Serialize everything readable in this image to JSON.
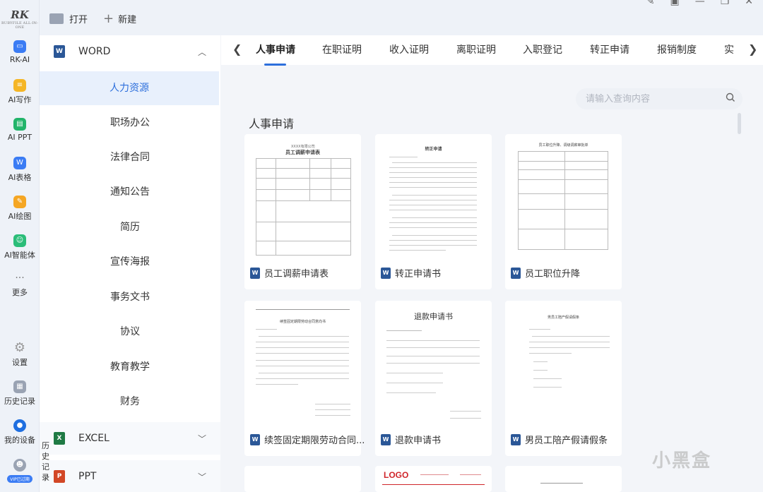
{
  "app": {
    "logo_text": "RK",
    "logo_subtext": "RUBYFILE ALL-IN-ONE"
  },
  "rail": [
    {
      "label": "RK-AI",
      "icon": "rk-ai-icon",
      "color": "#3b7cf4"
    },
    {
      "label": "AI写作",
      "icon": "ai-write-icon",
      "color": "#f5b626"
    },
    {
      "label": "AI PPT",
      "icon": "ai-ppt-icon",
      "color": "#22b46a"
    },
    {
      "label": "AI表格",
      "icon": "ai-table-icon",
      "color": "#3b7cf4"
    },
    {
      "label": "AI绘图",
      "icon": "ai-draw-icon",
      "color": "#f5a623"
    },
    {
      "label": "AI智能体",
      "icon": "ai-agent-icon",
      "color": "#2bbd79"
    },
    {
      "label": "更多",
      "icon": "more-icon",
      "color": "#777777"
    },
    {
      "label": "设置",
      "icon": "gear-icon",
      "color": "#9aa3b3"
    },
    {
      "label": "历史记录",
      "icon": "history-icon",
      "color": "#9aa3b3"
    },
    {
      "label": "我的设备",
      "icon": "device-icon",
      "color": "#1f6fe0"
    },
    {
      "label": "VIP已过期",
      "icon": "avatar-icon",
      "color": "#9aa3b3"
    }
  ],
  "topbar": {
    "open_label": "打开",
    "new_label": "新建"
  },
  "categories": {
    "word": {
      "label": "WORD",
      "badge": "W",
      "color": "#2b5797"
    },
    "word_items": [
      "人力资源",
      "职场办公",
      "法律合同",
      "通知公告",
      "简历",
      "宣传海报",
      "事务文书",
      "协议",
      "教育教学",
      "财务"
    ],
    "excel": {
      "label": "EXCEL",
      "badge": "X",
      "color": "#1f7a44"
    },
    "ppt": {
      "label": "PPT",
      "badge": "P",
      "color": "#d24726"
    },
    "vertical_text": "历史记录"
  },
  "tabs": [
    "人事申请",
    "在职证明",
    "收入证明",
    "离职证明",
    "入职登记",
    "转正申请",
    "报销制度",
    "实"
  ],
  "search": {
    "placeholder": "请输入查询内容"
  },
  "section_title": "人事申请",
  "cards": [
    {
      "title": "员工调薪申请表",
      "doc_heading": "员工调薪申请表",
      "doc_company": "XXXX有限公司"
    },
    {
      "title": "转正申请书",
      "doc_heading": "转正申请"
    },
    {
      "title": "员工职位升降",
      "doc_heading": "员工职位升降、调级调薪审批单"
    },
    {
      "title": "续签固定期限劳动合同...",
      "doc_heading": "续签固定期限劳动合同意向书"
    },
    {
      "title": "退款申请书",
      "doc_heading": "退款申请书"
    },
    {
      "title": "男员工陪产假请假条",
      "doc_heading": "男员工陪产假请假条"
    }
  ],
  "bottom_card": {
    "logo": "LOGO"
  },
  "watermark": "小黑盒"
}
